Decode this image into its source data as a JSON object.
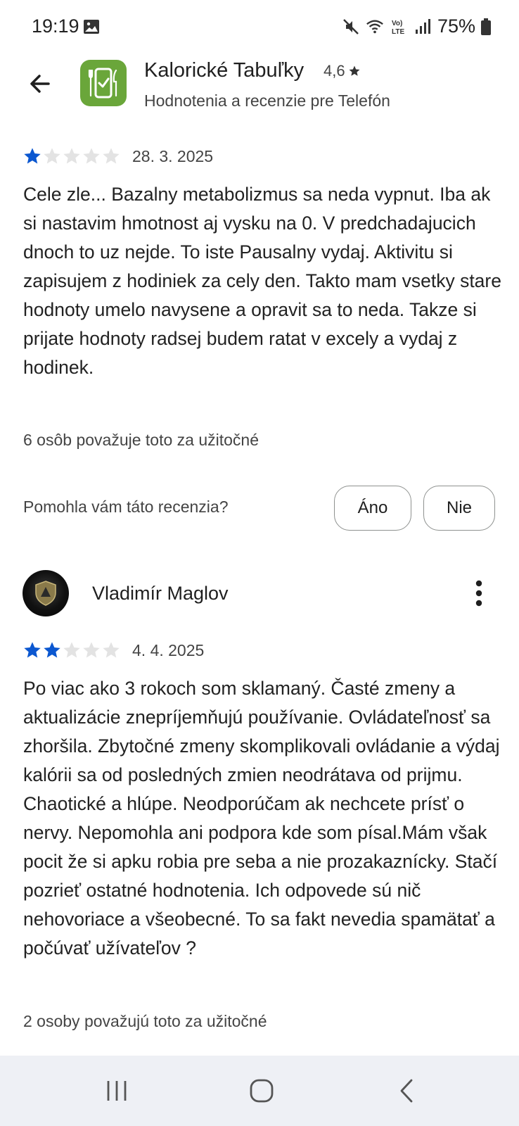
{
  "status_bar": {
    "time": "19:19",
    "battery_percent": "75%",
    "icons": [
      "gallery-icon",
      "mute-icon",
      "wifi-icon",
      "volte-icon",
      "signal-icon",
      "battery-icon"
    ]
  },
  "header": {
    "app_name": "Kalorické Tabuľky",
    "rating": "4,6",
    "subtitle": "Hodnotenia a recenzie pre Telefón",
    "app_icon_color": "#6aa63a"
  },
  "reviews": [
    {
      "stars": 1,
      "date": "28. 3. 2025",
      "text": "Cele zle... Bazalny metabolizmus sa neda vypnut. Iba ak si nastavim hmotnost aj vysku na 0. V predchadajucich dnoch to uz nejde. To iste Pausalny vydaj. Aktivitu si zapisujem z hodiniek za cely den. Takto mam vsetky stare hodnoty umelo navysene a opravit sa to neda. Takze si prijate hodnoty radsej budem ratat v excely a vydaj z hodinek.",
      "helpful": "6 osôb považuje toto za užitočné"
    },
    {
      "author": "Vladimír Maglov",
      "stars": 2,
      "date": "4. 4. 2025",
      "text": "Po viac ako 3 rokoch som sklamaný. Časté zmeny a aktualizácie znepríjemňujú používanie. Ovládateľnosť sa zhoršila. Zbytočné zmeny skomplikovali ovládanie a výdaj kalórii sa od posledných zmien neodrátava od prijmu. Chaotické a hlúpe. Neodporúčam ak nechcete prísť o nervy. Nepomohla ani podpora kde som písal.Mám však pocit že si apku robia pre seba a nie prozakaznícky. Stačí pozrieť ostatné hodnotenia. Ich odpovede sú nič nehovoriace a všeobecné. To sa fakt nevedia spamätať a počúvať užívateľov ?",
      "helpful": "2 osoby považujú toto za užitočné"
    }
  ],
  "feedback": {
    "question": "Pomohla vám táto recenzia?",
    "yes_label": "Áno",
    "no_label": "Nie"
  },
  "colors": {
    "star_filled": "#0b57d0",
    "star_empty": "#e3e3e3",
    "nav_bar_bg": "#eef0f5"
  }
}
